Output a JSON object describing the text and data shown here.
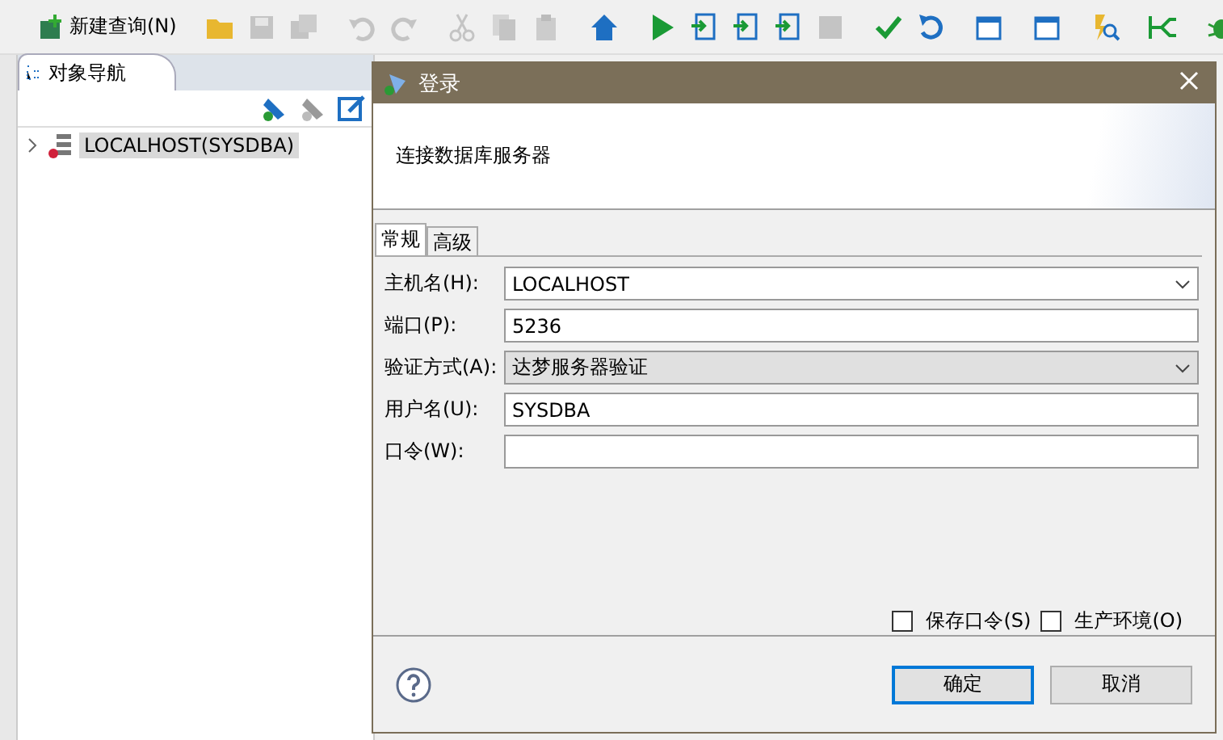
{
  "toolbar": [
    {
      "kind": "new",
      "label": "新建查询(N)",
      "disabled": false
    },
    {
      "kind": "sep"
    },
    {
      "kind": "folder",
      "disabled": false
    },
    {
      "kind": "save",
      "disabled": true
    },
    {
      "kind": "saveall",
      "disabled": true
    },
    {
      "kind": "sep"
    },
    {
      "kind": "undo",
      "disabled": true
    },
    {
      "kind": "redo",
      "disabled": true
    },
    {
      "kind": "sep"
    },
    {
      "kind": "cut",
      "disabled": true
    },
    {
      "kind": "copy",
      "disabled": true
    },
    {
      "kind": "paste",
      "disabled": true
    },
    {
      "kind": "sep"
    },
    {
      "kind": "home",
      "disabled": false
    },
    {
      "kind": "sep"
    },
    {
      "kind": "run",
      "disabled": false
    },
    {
      "kind": "doc",
      "disabled": false
    },
    {
      "kind": "doc",
      "disabled": false
    },
    {
      "kind": "doc",
      "disabled": false
    },
    {
      "kind": "stop",
      "disabled": true
    },
    {
      "kind": "sep"
    },
    {
      "kind": "check",
      "disabled": false
    },
    {
      "kind": "undo2",
      "disabled": false
    },
    {
      "kind": "sep"
    },
    {
      "kind": "cal",
      "disabled": false
    },
    {
      "kind": "sep"
    },
    {
      "kind": "cal",
      "disabled": false
    },
    {
      "kind": "sep"
    },
    {
      "kind": "find",
      "disabled": false
    },
    {
      "kind": "sep"
    },
    {
      "kind": "flow",
      "disabled": false
    },
    {
      "kind": "sep"
    },
    {
      "kind": "bug",
      "disabled": false
    }
  ],
  "navigator": {
    "tab": "对象导航",
    "tree": [
      {
        "label": "LOCALHOST(SYSDBA)",
        "selected": true,
        "expanded": false
      }
    ]
  },
  "dialog": {
    "title": "登录",
    "heading": "连接数据库服务器",
    "tabs": [
      {
        "label": "常规",
        "selected": true
      },
      {
        "label": "高级",
        "selected": false
      }
    ],
    "fields": [
      {
        "kind": "combo",
        "label": "主机名(H):",
        "value": "LOCALHOST",
        "disabled": false
      },
      {
        "kind": "text",
        "label": "端口(P):",
        "value": "5236",
        "disabled": false
      },
      {
        "kind": "combo",
        "label": "验证方式(A):",
        "value": "达梦服务器验证",
        "disabled": true
      },
      {
        "kind": "text",
        "label": "用户名(U):",
        "value": "SYSDBA",
        "disabled": false
      },
      {
        "kind": "text",
        "label": "口令(W):",
        "disabled": false
      }
    ],
    "options": [
      {
        "label": "保存口令(S)",
        "checked": false
      },
      {
        "label": "生产环境(O)",
        "checked": false
      }
    ],
    "buttons": [
      {
        "label": "确定",
        "default": true
      },
      {
        "label": "取消",
        "default": false
      }
    ]
  }
}
